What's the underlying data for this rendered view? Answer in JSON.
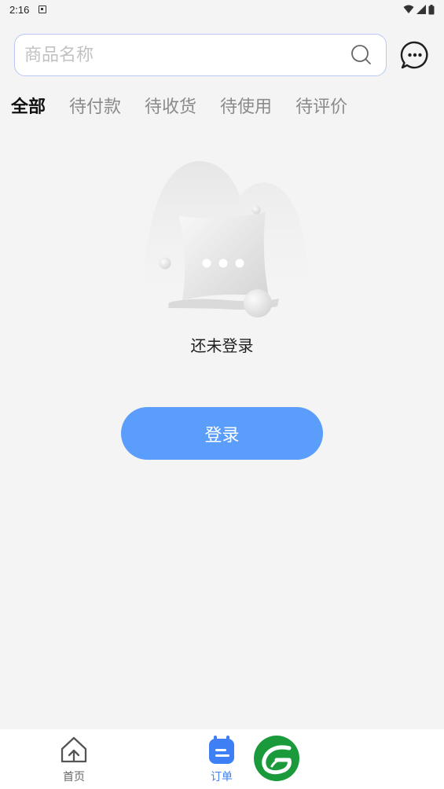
{
  "status_bar": {
    "time": "2:16"
  },
  "search": {
    "placeholder": "商品名称"
  },
  "tabs": [
    {
      "label": "全部",
      "active": true
    },
    {
      "label": "待付款",
      "active": false
    },
    {
      "label": "待收货",
      "active": false
    },
    {
      "label": "待使用",
      "active": false
    },
    {
      "label": "待评价",
      "active": false
    }
  ],
  "empty_state": {
    "message": "还未登录"
  },
  "login_button": {
    "label": "登录"
  },
  "bottom_nav": {
    "items": [
      {
        "label": "首页",
        "icon": "home-icon",
        "active": false
      },
      {
        "label": "订单",
        "icon": "order-icon",
        "active": true
      }
    ],
    "logo_icon": "leaf-logo-icon"
  },
  "colors": {
    "accent": "#5b9dfb",
    "active_nav": "#3f7ff5",
    "tab_highlight": "#9cc2ff",
    "background": "#f4f4f4",
    "logo_green": "#1a9a3a"
  }
}
